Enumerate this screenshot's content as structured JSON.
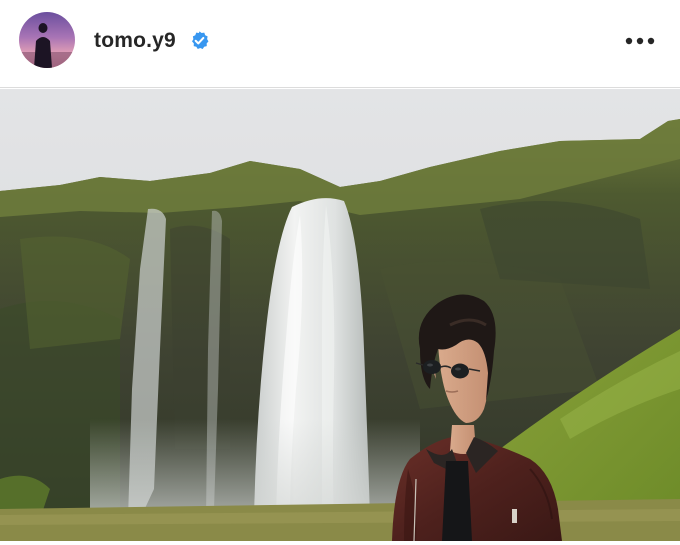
{
  "post": {
    "author": {
      "username": "tomo.y9",
      "verified": true
    },
    "icons": {
      "avatar": "profile-avatar",
      "badge": "verified-badge-icon",
      "menu": "more-options-icon"
    },
    "colors": {
      "verified_blue": "#3897f0",
      "text": "#262626",
      "divider": "#dcdcdc"
    }
  }
}
